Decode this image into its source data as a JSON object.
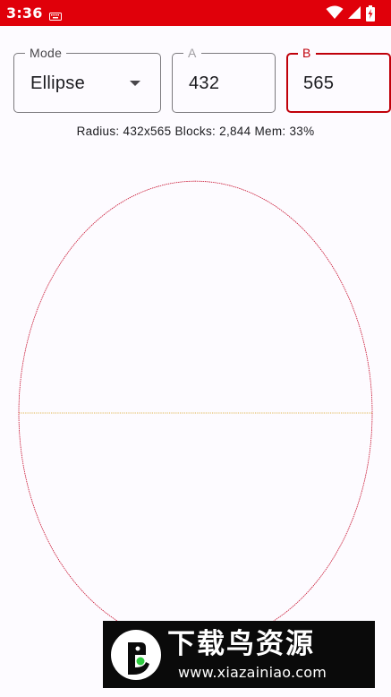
{
  "status_bar": {
    "time": "3:36",
    "background_color": "#e0000a",
    "icons": [
      "keyboard-icon",
      "wifi-icon",
      "signal-icon",
      "battery-charging-icon"
    ]
  },
  "mode_field": {
    "label": "Mode",
    "value": "Ellipse"
  },
  "a_field": {
    "label": "A",
    "value": "432"
  },
  "b_field": {
    "label": "B",
    "value": "565",
    "state": "focused"
  },
  "info": {
    "text": "Radius: 432x565 Blocks: 2,844 Mem: 33%"
  },
  "drawing": {
    "shape": "ellipse",
    "a": 432,
    "b": 565,
    "outline_color": "#c8102e",
    "axis_color": "#d4a017"
  },
  "watermark": {
    "title": "下载鸟资源",
    "url": "www.xiazainiao.com"
  }
}
